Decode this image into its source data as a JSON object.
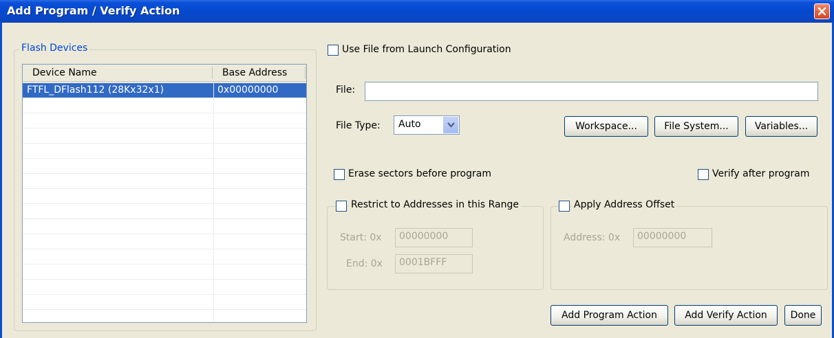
{
  "window": {
    "title": "Add Program / Verify Action"
  },
  "flash_devices": {
    "legend": "Flash Devices",
    "columns": [
      "Device Name",
      "Base Address"
    ],
    "rows": [
      {
        "device_name": "FTFL_DFlash112 (28Kx32x1)",
        "base_address": "0x00000000",
        "selected": true
      }
    ]
  },
  "file_options": {
    "use_launch_config_label": "Use File from Launch Configuration",
    "file_label": "File:",
    "file_value": "",
    "file_type_label": "File Type:",
    "file_type_value": "Auto",
    "workspace_button": "Workspace...",
    "file_system_button": "File System...",
    "variables_button": "Variables..."
  },
  "program_options": {
    "erase_label": "Erase sectors before program",
    "verify_label": "Verify after program",
    "restrict_label": "Restrict to Addresses in this Range",
    "start_label": "Start: 0x",
    "start_value": "00000000",
    "end_label": "End: 0x",
    "end_value": "0001BFFF",
    "offset_label": "Apply Address Offset",
    "address_label": "Address: 0x",
    "address_value": "00000000"
  },
  "actions": {
    "add_program": "Add Program Action",
    "add_verify": "Add Verify Action",
    "done": "Done"
  }
}
